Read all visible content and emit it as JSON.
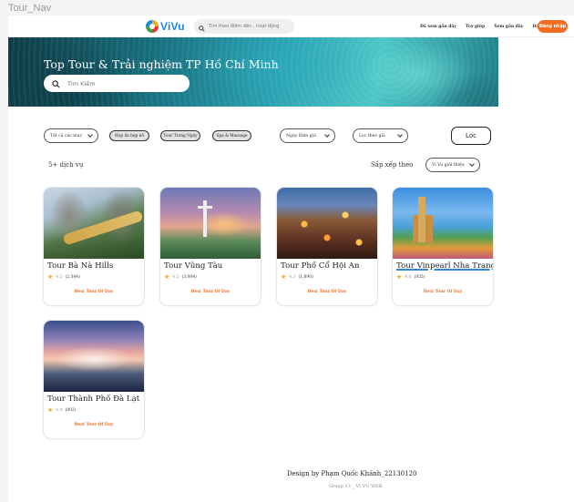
{
  "frame_label": "Tour_Nav",
  "nav": {
    "logo_text": "ViVu",
    "search_placeholder": "Tìm theo điểm đến , hoạt động",
    "links": [
      "Đã xem gần đây",
      "Trợ giúp",
      "Xem gần đây",
      "Đăng ký"
    ],
    "login_label": "Đăng nhập"
  },
  "hero": {
    "title": "Top Tour & Trải nghiệm TP Hồ Chí Minh",
    "search_placeholder": "Tìm Kiếm"
  },
  "filters": {
    "category_label": "Tất cả các mục",
    "chips": [
      "Họp ăn hẹp nở",
      "Tour Trong Ngày",
      "Spa & Massage"
    ],
    "date_label": "Ngày Bàm giá",
    "price_label": "Lọc theo giá",
    "filter_button": "Lọc"
  },
  "results": {
    "count": "5+ dịch vụ",
    "sort_label": "Sắp xếp theo",
    "sort_value": "Vi Vu giới thiệu"
  },
  "cards": [
    {
      "title": "Tour Bà Nà Hills",
      "rating": "4.5",
      "reviews": "(2,344)",
      "badge": "Best Tour Of Day"
    },
    {
      "title": "Tour Vũng Tàu",
      "rating": "4.5",
      "reviews": "(3,004)",
      "badge": "Best Tour Of Day"
    },
    {
      "title": "Tour Phố Cổ Hội An",
      "rating": "4.3",
      "reviews": "(1,890)",
      "badge": "Best Tour Of Day"
    },
    {
      "title": "Tour Vinpearl Nha Trang",
      "rating": "4.8",
      "reviews": "(935)",
      "badge": "Best Tour Of Day"
    },
    {
      "title": "Tour Thành Phố Đà Lạt",
      "rating": "4.4",
      "reviews": "(802)",
      "badge": "Best Tour Of Day"
    }
  ],
  "footer": {
    "design": "Design by Phạm Quốc Khánh_22130120",
    "group": "Group 13 _ VI VU WEB"
  },
  "colors": {
    "accent": "#f36b21",
    "brand": "#1e88e5",
    "star": "#f5a623"
  }
}
